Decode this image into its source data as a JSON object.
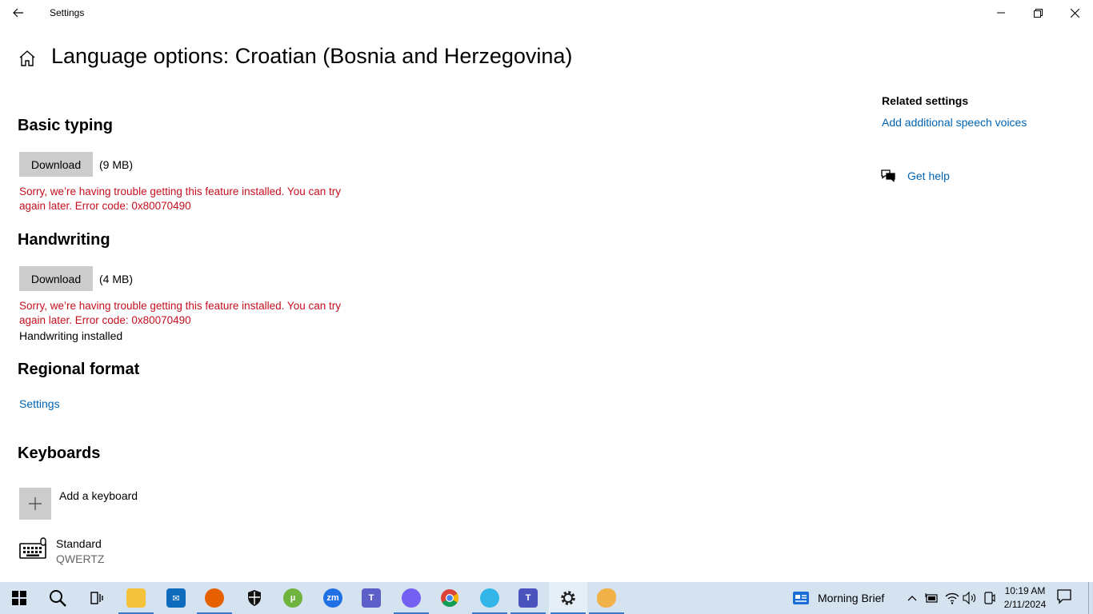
{
  "window": {
    "app_title": "Settings"
  },
  "page": {
    "title": "Language options: Croatian (Bosnia and Herzegovina)"
  },
  "basic_typing": {
    "heading": "Basic typing",
    "download_label": "Download",
    "size": "(9 MB)",
    "error": "Sorry, we’re having trouble getting this feature installed. You can try again later. Error code: 0x80070490"
  },
  "handwriting": {
    "heading": "Handwriting",
    "download_label": "Download",
    "size": "(4 MB)",
    "error": "Sorry, we’re having trouble getting this feature installed. You can try again later. Error code: 0x80070490",
    "status": "Handwriting installed"
  },
  "regional_format": {
    "heading": "Regional format",
    "settings_link": "Settings"
  },
  "keyboards": {
    "heading": "Keyboards",
    "add_label": "Add a keyboard",
    "items": [
      {
        "name": "Standard",
        "layout": "QWERTZ"
      }
    ]
  },
  "related": {
    "heading": "Related settings",
    "speech_link": "Add additional speech voices",
    "help_link": "Get help"
  },
  "taskbar": {
    "apps": [
      {
        "name": "search-icon"
      },
      {
        "name": "task-view-icon"
      },
      {
        "name": "file-explorer-icon"
      },
      {
        "name": "mail-icon"
      },
      {
        "name": "firefox-icon"
      },
      {
        "name": "security-icon"
      },
      {
        "name": "utorrent-icon"
      },
      {
        "name": "zoom-icon"
      },
      {
        "name": "teams-icon"
      },
      {
        "name": "viber-icon"
      },
      {
        "name": "chrome-icon"
      },
      {
        "name": "app-icon"
      },
      {
        "name": "teams-work-icon"
      },
      {
        "name": "settings-icon"
      },
      {
        "name": "paint-icon"
      }
    ],
    "news_label": "Morning Brief",
    "time": "10:19 AM",
    "date": "2/11/2024"
  },
  "colors": {
    "accent": "#0063b1",
    "error": "#c50f1f",
    "taskbar": "#d5e3f1"
  }
}
